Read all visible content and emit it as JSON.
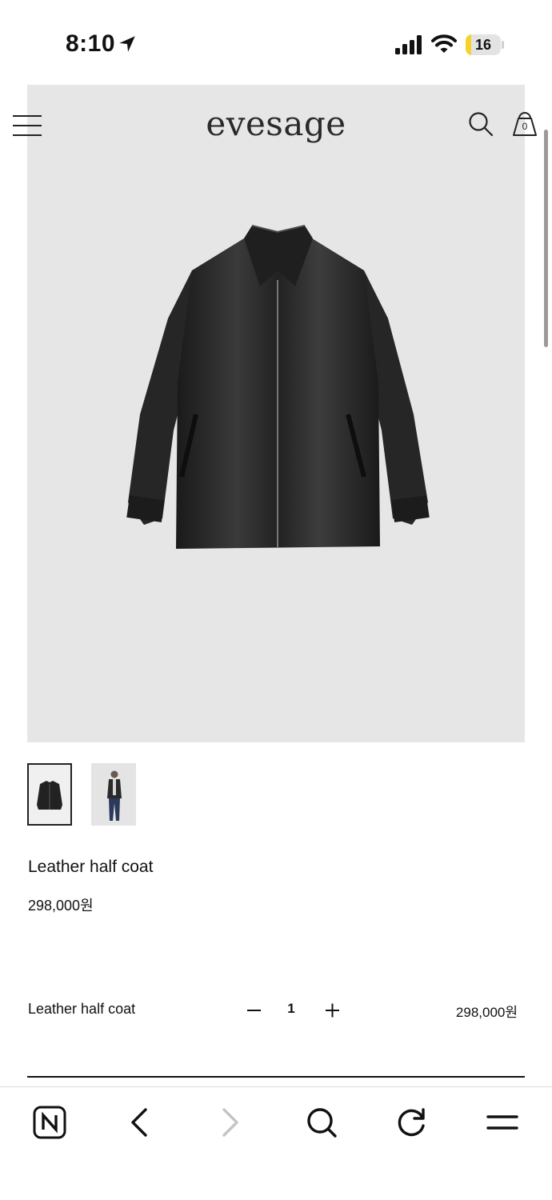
{
  "status_bar": {
    "time": "8:10",
    "battery_level": "16",
    "battery_fraction": 0.16,
    "icons": [
      "location-arrow-icon",
      "cellular-signal-icon",
      "wifi-icon",
      "battery-icon"
    ]
  },
  "header": {
    "brand": "evesage",
    "menu_icon": "hamburger-menu-icon",
    "search_icon": "search-icon",
    "cart_icon": "shopping-bag-icon",
    "cart_count": "0"
  },
  "product": {
    "name": "Leather half coat",
    "price": "298,000원",
    "main_image": "black-leather-jacket-image",
    "thumbnails": [
      "jacket-flat-thumbnail",
      "model-wearing-jacket-thumbnail"
    ]
  },
  "order_option": {
    "name": "Leather half coat",
    "quantity": "1",
    "price": "298,000원"
  },
  "browser_bar": {
    "icons": [
      "naver-home-icon",
      "back-icon",
      "forward-icon",
      "search-icon",
      "reload-icon",
      "menu-icon"
    ]
  },
  "colors": {
    "hero_background": "#e6e6e6",
    "text": "#111111",
    "battery_fill": "#f6d12a"
  }
}
